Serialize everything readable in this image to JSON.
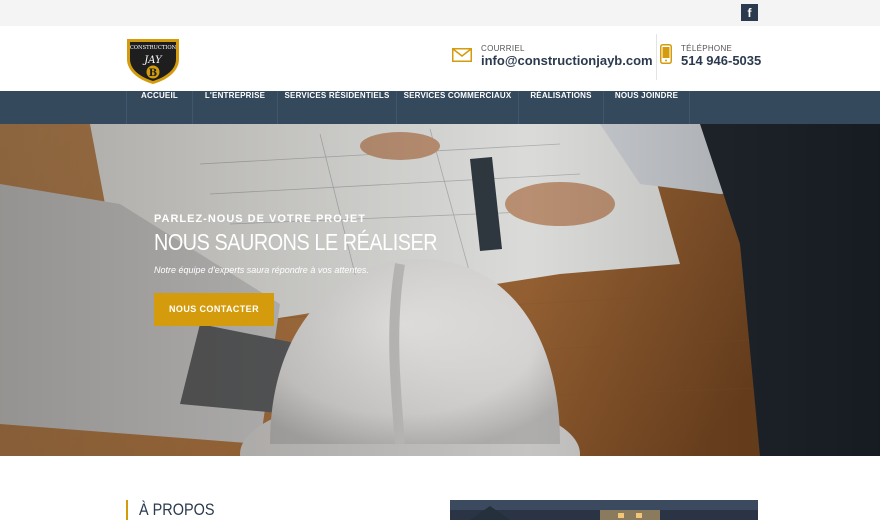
{
  "topbar": {
    "facebook_glyph": "f",
    "facebook_icon": "facebook-icon"
  },
  "logo": {
    "line1": "CONSTRUCTION",
    "line2": "JAY",
    "line3": "B",
    "colors": {
      "gold": "#d49b0c",
      "dark": "#1e1e1e"
    }
  },
  "contact": {
    "email_label": "COURRIEL",
    "email_value": "info@constructionjayb.com",
    "email_icon": "mail-icon",
    "phone_label": "TÉLÉPHONE",
    "phone_value": "514 946-5035",
    "phone_icon": "phone-icon"
  },
  "nav": {
    "items": [
      {
        "label": "ACCUEIL"
      },
      {
        "label": "L'ENTREPRISE"
      },
      {
        "label": "SERVICES RÉSIDENTIELS"
      },
      {
        "label": "SERVICES COMMERCIAUX"
      },
      {
        "label": "RÉALISATIONS"
      },
      {
        "label": "NOUS JOINDRE"
      }
    ]
  },
  "hero": {
    "kicker": "PARLEZ-NOUS DE VOTRE PROJET",
    "title": "NOUS SAURONS LE RÉALISER",
    "subtitle": "Notre équipe d'experts saura répondre à vos attentes.",
    "cta_label": "NOUS CONTACTER"
  },
  "about": {
    "title": "À PROPOS"
  },
  "colors": {
    "accent": "#d49b0c",
    "nav_bg": "#34495c",
    "text_dark": "#2b3a4e",
    "topbar_bg": "#f4f4f4"
  }
}
